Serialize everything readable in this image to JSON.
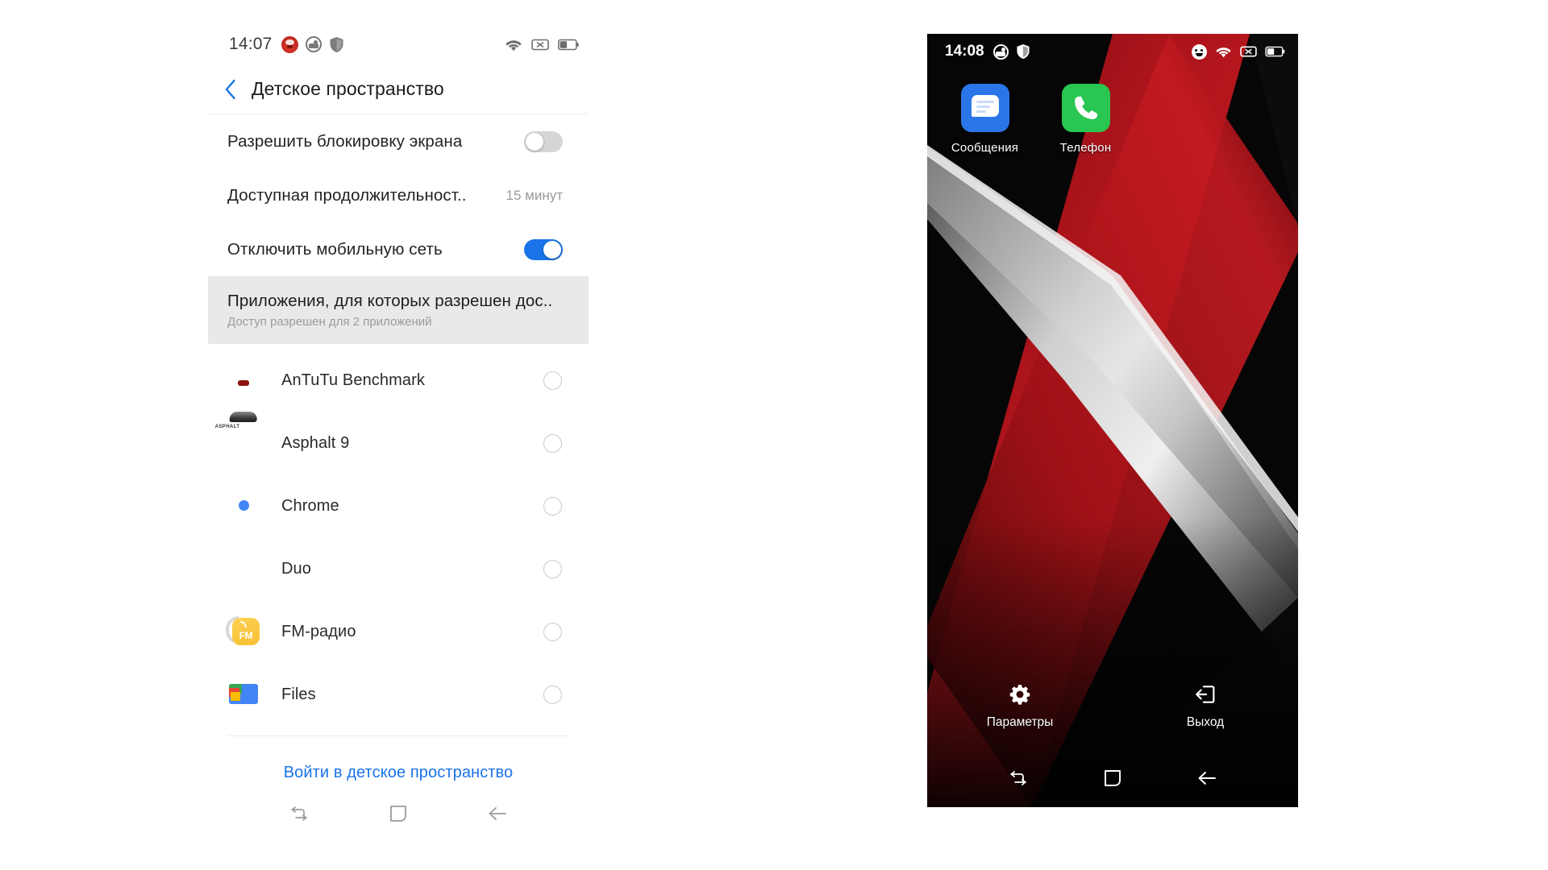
{
  "left_phone": {
    "status_bar": {
      "time": "14:07",
      "left_icons": [
        "antutu-icon",
        "globe-icon",
        "shield-icon"
      ],
      "right_icons": [
        "wifi-icon",
        "no-sim-icon",
        "battery-icon"
      ]
    },
    "header": {
      "back_icon": "chevron-left-icon",
      "title": "Детское пространство"
    },
    "settings_rows": [
      {
        "label": "Разрешить блокировку экрана",
        "control": "toggle",
        "state": "off"
      },
      {
        "label": "Доступная продолжительност..",
        "control": "value",
        "value": "15 минут"
      },
      {
        "label": "Отключить мобильную сеть",
        "control": "toggle",
        "state": "on"
      }
    ],
    "apps_access": {
      "title": "Приложения, для которых разрешен дос..",
      "subtitle": "Доступ разрешен для 2 приложений"
    },
    "apps": [
      {
        "name": "AnTuTu Benchmark",
        "icon": "antutu-app-icon",
        "selected": false
      },
      {
        "name": "Asphalt 9",
        "icon": "asphalt-app-icon",
        "selected": false
      },
      {
        "name": "Chrome",
        "icon": "chrome-app-icon",
        "selected": false
      },
      {
        "name": "Duo",
        "icon": "duo-app-icon",
        "selected": false
      },
      {
        "name": "FM-радио",
        "icon": "fm-radio-app-icon",
        "selected": false
      },
      {
        "name": "Files",
        "icon": "files-app-icon",
        "selected": false
      }
    ],
    "enter_button": "Войти в детское пространство",
    "nav_bar": [
      "recents-icon",
      "home-icon",
      "back-icon"
    ],
    "colors": {
      "accent": "#1a73e8",
      "highlight_bg": "#e9e9e9",
      "toggle_off": "#d6d6d6"
    }
  },
  "right_phone": {
    "status_bar": {
      "time": "14:08",
      "left_icons": [
        "globe-icon",
        "shield-icon"
      ],
      "right_icons": [
        "kid-face-icon",
        "wifi-icon",
        "no-sim-icon",
        "battery-icon"
      ]
    },
    "home_apps": [
      {
        "label": "Сообщения",
        "icon": "messages-app-icon"
      },
      {
        "label": "Телефон",
        "icon": "phone-app-icon"
      }
    ],
    "bottom_actions": [
      {
        "label": "Параметры",
        "icon": "gear-icon"
      },
      {
        "label": "Выход",
        "icon": "exit-icon"
      }
    ],
    "nav_bar": [
      "recents-icon",
      "home-icon",
      "back-icon"
    ],
    "wallpaper": {
      "description": "abstract red and silver diagonal bands on black",
      "colors": [
        "#000000",
        "#b5151a",
        "#7c0d10",
        "#d9d9d9",
        "#8a8a8a"
      ]
    }
  }
}
